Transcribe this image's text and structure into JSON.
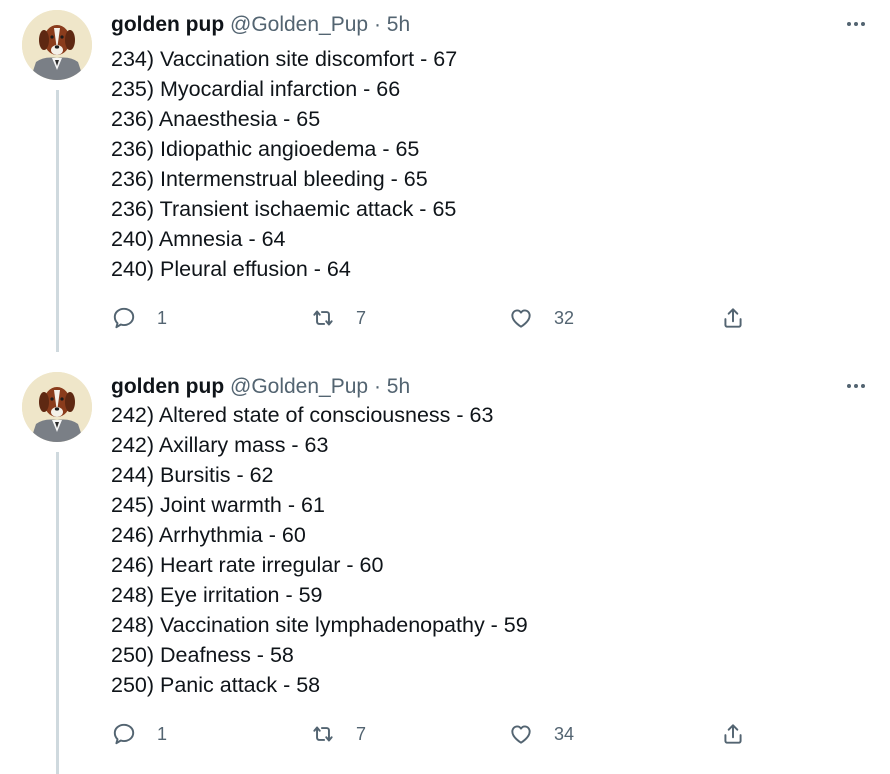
{
  "tweets": [
    {
      "author": {
        "name": "golden pup",
        "handle": "@Golden_Pup",
        "separator": "·",
        "time": "5h"
      },
      "lines": [
        "234) Vaccination site discomfort - 67",
        "235) Myocardial infarction - 66",
        "236) Anaesthesia - 65",
        "236) Idiopathic angioedema - 65",
        "236) Intermenstrual bleeding - 65",
        "236) Transient ischaemic attack - 65",
        "240) Amnesia - 64",
        "240) Pleural effusion - 64"
      ],
      "actions": {
        "replies": "1",
        "retweets": "7",
        "likes": "32"
      }
    },
    {
      "author": {
        "name": "golden pup",
        "handle": "@Golden_Pup",
        "separator": "·",
        "time": "5h"
      },
      "lines": [
        "242) Altered state of consciousness - 63",
        "242) Axillary mass - 63",
        "244) Bursitis - 62",
        "245) Joint warmth - 61",
        "246) Arrhythmia - 60",
        "246) Heart rate irregular - 60",
        "248) Eye irritation - 59",
        "248) Vaccination site lymphadenopathy - 59",
        "250) Deafness - 58",
        "250) Panic attack - 58"
      ],
      "actions": {
        "replies": "1",
        "retweets": "7",
        "likes": "34"
      }
    }
  ],
  "icons": {
    "reply": "speech-bubble-icon",
    "retweet": "retweet-arrows-icon",
    "like": "heart-outline-icon",
    "share": "share-upload-icon",
    "more": "more-dots-icon"
  },
  "colors": {
    "text": "#0f1419",
    "secondary": "#536471",
    "thread_line": "#cfd9de"
  }
}
